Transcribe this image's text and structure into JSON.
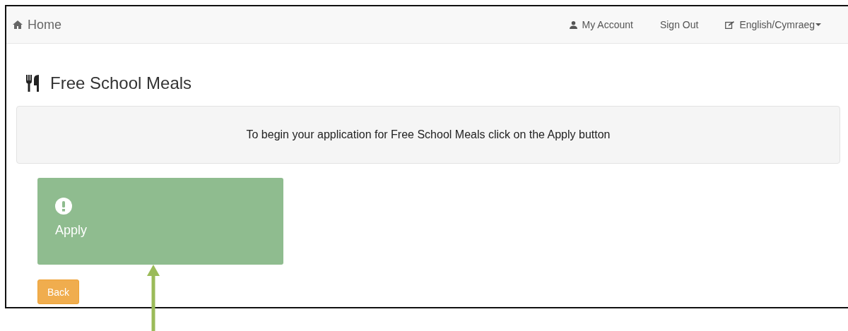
{
  "navbar": {
    "home": "Home",
    "links": [
      {
        "kind": "account",
        "label": "My Account"
      },
      {
        "kind": "plain",
        "label": "Sign Out"
      },
      {
        "kind": "language",
        "label": "English/Cymraeg"
      }
    ]
  },
  "page": {
    "title": "Free School Meals",
    "message": "To begin your application for Free School Meals click on the Apply button"
  },
  "tiles": [
    {
      "label": "Apply"
    }
  ],
  "buttons": [
    {
      "label": "Back"
    }
  ]
}
